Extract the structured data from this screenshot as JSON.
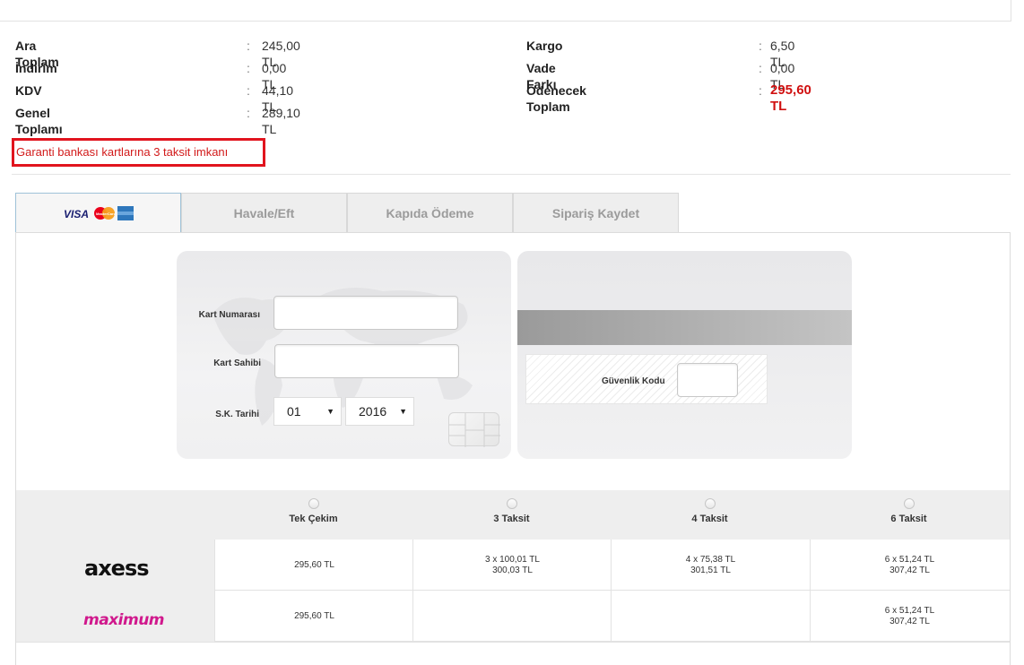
{
  "summary": {
    "left": [
      {
        "label": "Ara Toplam",
        "sep": ":",
        "value": "245,00 TL"
      },
      {
        "label": "İndirim",
        "sep": ":",
        "value": "0,00 TL"
      },
      {
        "label": "KDV",
        "sep": ":",
        "value": "44,10 TL"
      },
      {
        "label": "Genel Toplamı",
        "sep": ":",
        "value": "289,10 TL"
      }
    ],
    "right": [
      {
        "label": "Kargo",
        "sep": ":",
        "value": "6,50 TL"
      },
      {
        "label": "Vade Farkı",
        "sep": ":",
        "value": "0,00 TL"
      },
      {
        "label": "Ödenecek Toplam",
        "sep": ":",
        "value": "295,60 TL"
      }
    ]
  },
  "promo": "Garanti bankası kartlarına 3 taksit imkanı",
  "tabs": [
    {
      "label": ""
    },
    {
      "label": "Havale/Eft"
    },
    {
      "label": "Kapıda Ödeme"
    },
    {
      "label": "Sipariş Kaydet"
    }
  ],
  "card_logos": {
    "visa": "VISA",
    "mastercard": "MasterCard"
  },
  "form": {
    "card_number_label": "Kart Numarası",
    "card_holder_label": "Kart Sahibi",
    "expiry_label": "S.K. Tarihi",
    "expiry_month": "01",
    "expiry_year": "2016",
    "cvc_label": "Güvenlik Kodu"
  },
  "installments": {
    "headers": [
      "Tek Çekim",
      "3 Taksit",
      "4 Taksit",
      "6 Taksit"
    ],
    "rows": [
      {
        "bank": "axess",
        "cells": [
          [
            "295,60 TL"
          ],
          [
            "3 x 100,01 TL",
            "300,03 TL"
          ],
          [
            "4 x 75,38 TL",
            "301,51 TL"
          ],
          [
            "6 x 51,24 TL",
            "307,42 TL"
          ]
        ]
      },
      {
        "bank": "maximum",
        "cells": [
          [
            "295,60 TL"
          ],
          [],
          [],
          [
            "6 x 51,24 TL",
            "307,42 TL"
          ]
        ]
      }
    ]
  },
  "colors": {
    "total_red": "#d01010",
    "promo_border": "#e1141e",
    "maximum_pink": "#d0188c",
    "tab_bg": "#eeeeee"
  }
}
